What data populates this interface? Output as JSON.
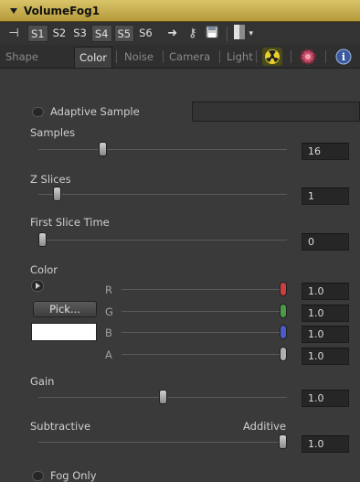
{
  "window": {
    "title": "VolumeFog1"
  },
  "toolbar": {
    "slots": [
      {
        "label": "S1",
        "on": true
      },
      {
        "label": "S2",
        "on": false
      },
      {
        "label": "S3",
        "on": false
      },
      {
        "label": "S4",
        "on": true
      },
      {
        "label": "S5",
        "on": true
      },
      {
        "label": "S6",
        "on": false
      }
    ]
  },
  "tabs": {
    "shape": "Shape",
    "color": "Color",
    "noise": "Noise",
    "camera": "Camera",
    "light": "Light",
    "icons": [
      "radiation-icon",
      "gear-icon",
      "info-icon"
    ]
  },
  "controls": {
    "adaptive_sample": {
      "label": "Adaptive Sample",
      "checked": false
    },
    "samples": {
      "label": "Samples",
      "value": "16",
      "fraction": 0.25
    },
    "z_slices": {
      "label": "Z Slices",
      "value": "1",
      "fraction": 0.06
    },
    "first_slice_time": {
      "label": "First Slice Time",
      "value": "0",
      "fraction": 0.0
    },
    "color": {
      "label": "Color",
      "pick_label": "Pick...",
      "swatch": "#ffffff",
      "channels": [
        {
          "name": "R",
          "value": "1.0",
          "fraction": 1.0,
          "thumb_color": "#c84040"
        },
        {
          "name": "G",
          "value": "1.0",
          "fraction": 1.0,
          "thumb_color": "#4a9a4a"
        },
        {
          "name": "B",
          "value": "1.0",
          "fraction": 1.0,
          "thumb_color": "#4a5ac8"
        },
        {
          "name": "A",
          "value": "1.0",
          "fraction": 1.0,
          "thumb_color": "#b0b0b0"
        }
      ]
    },
    "gain": {
      "label": "Gain",
      "value": "1.0",
      "fraction": 0.5
    },
    "subtractive_additive": {
      "left_label": "Subtractive",
      "right_label": "Additive",
      "value": "1.0",
      "fraction": 1.0
    },
    "fog_only": {
      "label": "Fog Only",
      "checked": false
    }
  },
  "colors": {
    "title_bar": "#c9b050",
    "panel_bg": "#3a3a3a",
    "field_bg": "#262626"
  }
}
